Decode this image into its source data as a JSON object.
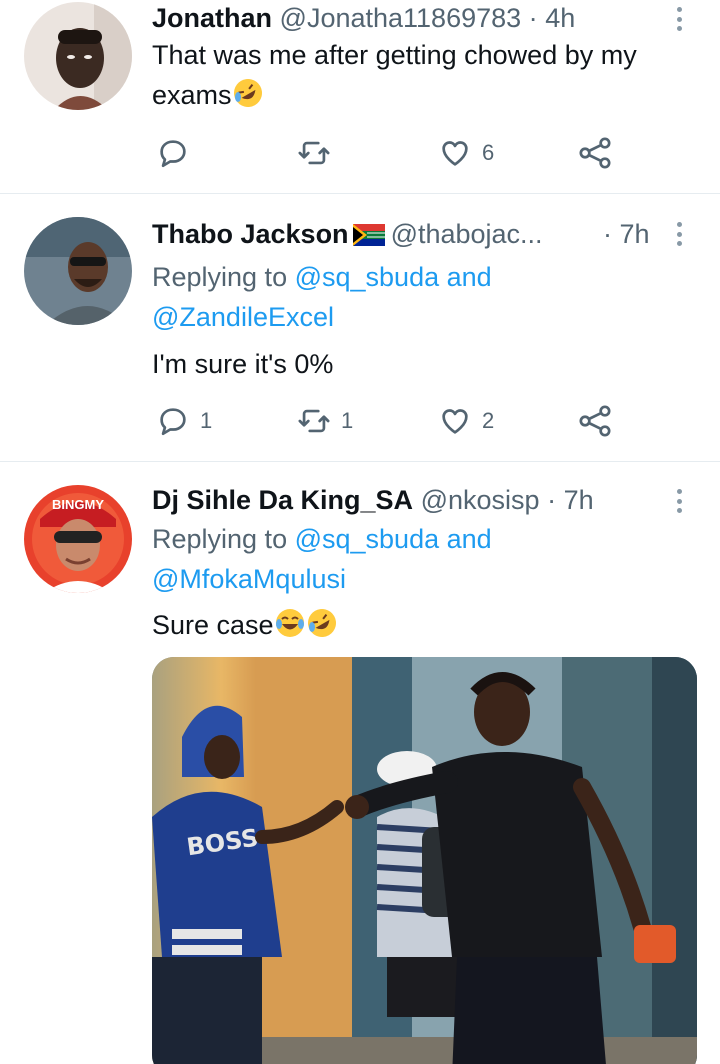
{
  "tweets": [
    {
      "name": "Jonathan",
      "handle": "@Jonatha11869783",
      "dot": "·",
      "time": "4h",
      "text": "That was me after getting chowed by my exams",
      "emoji": "rolling-on-floor-laughing",
      "stats": {
        "reply": "",
        "retweet": "",
        "like": "6"
      }
    },
    {
      "name": "Thabo Jackson",
      "flag": "south-africa-flag",
      "handle": "@thabojac...",
      "dot": "·",
      "time": "7h",
      "replying_prefix": "Replying to ",
      "replying_user1": "@sq_sbuda",
      "replying_and": " and",
      "replying_user2": "@ZandileExcel",
      "text": "I'm sure it's 0%",
      "stats": {
        "reply": "1",
        "retweet": "1",
        "like": "2"
      }
    },
    {
      "name": "Dj Sihle Da King_SA",
      "handle": "@nkosisp",
      "dot": "·",
      "time": "7h",
      "replying_prefix": "Replying to ",
      "replying_user1": "@sq_sbuda",
      "replying_and": " and",
      "replying_user2": "@MfokaMqulusi",
      "text": "Sure case",
      "emoji": [
        "face-with-tears-of-joy",
        "rolling-on-floor-laughing"
      ],
      "avatar_cap_text": "BINGMY",
      "photo_shirt_text": "BOSS"
    }
  ],
  "colors": {
    "link": "#1d9bf0",
    "muted": "#536471",
    "divider": "#e6ecf0"
  },
  "icons": [
    "reply-icon",
    "retweet-icon",
    "like-icon",
    "share-icon",
    "more-icon"
  ]
}
